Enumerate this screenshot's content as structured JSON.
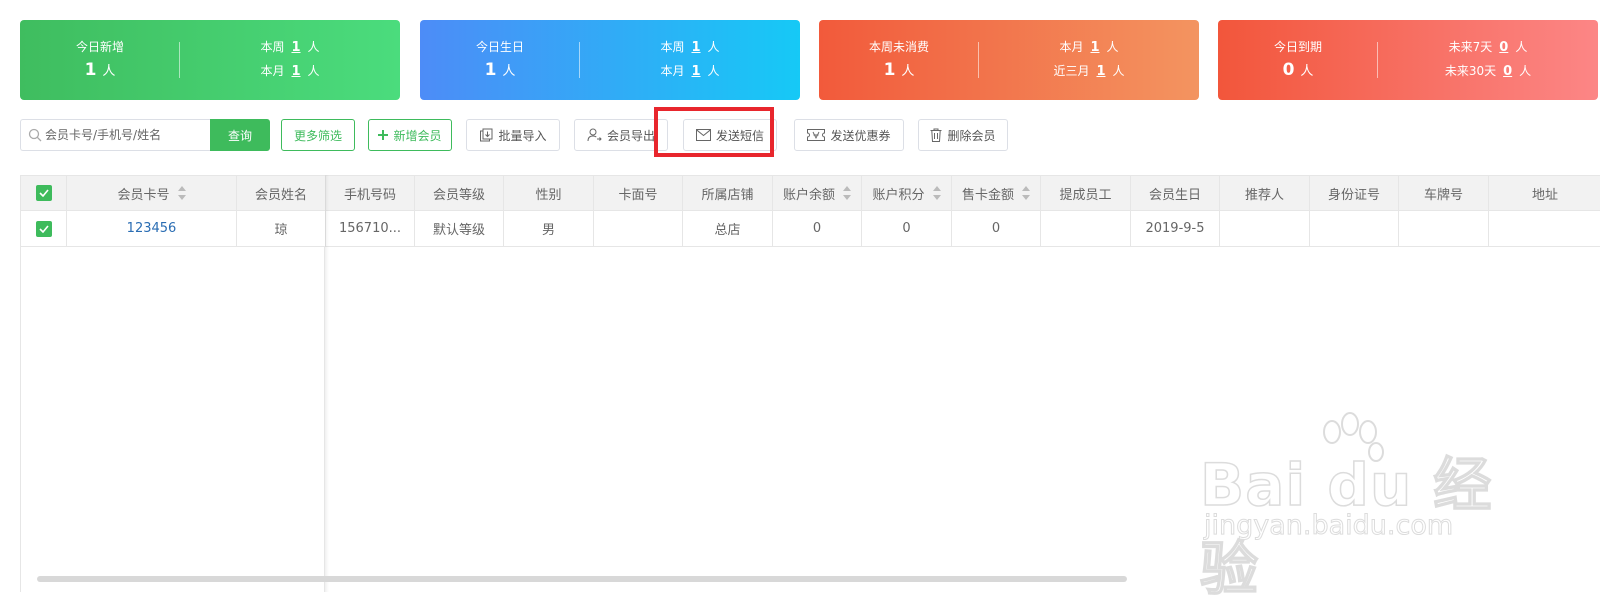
{
  "stats": [
    {
      "title": "今日新增",
      "value": "1",
      "unit": "人",
      "rows": [
        {
          "label": "本周",
          "value": "1",
          "unit": "人"
        },
        {
          "label": "本月",
          "value": "1",
          "unit": "人"
        }
      ]
    },
    {
      "title": "今日生日",
      "value": "1",
      "unit": "人",
      "rows": [
        {
          "label": "本周",
          "value": "1",
          "unit": "人"
        },
        {
          "label": "本月",
          "value": "1",
          "unit": "人"
        }
      ]
    },
    {
      "title": "本周未消费",
      "value": "1",
      "unit": "人",
      "rows": [
        {
          "label": "本月",
          "value": "1",
          "unit": "人"
        },
        {
          "label": "近三月",
          "value": "1",
          "unit": "人"
        }
      ]
    },
    {
      "title": "今日到期",
      "value": "0",
      "unit": "人",
      "rows": [
        {
          "label": "未来7天",
          "value": "0",
          "unit": "人"
        },
        {
          "label": "未来30天",
          "value": "0",
          "unit": "人"
        }
      ]
    }
  ],
  "toolbar": {
    "search_placeholder": "会员卡号/手机号/姓名",
    "query": "查询",
    "more_filter": "更多筛选",
    "add_member": "新增会员",
    "batch_import": "批量导入",
    "export_members": "会员导出",
    "send_sms": "发送短信",
    "send_coupon": "发送优惠券",
    "delete_member": "删除会员"
  },
  "table": {
    "headers": [
      "会员卡号",
      "会员姓名",
      "手机号码",
      "会员等级",
      "性别",
      "卡面号",
      "所属店铺",
      "账户余额",
      "账户积分",
      "售卡金额",
      "提成员工",
      "会员生日",
      "推荐人",
      "身份证号",
      "车牌号",
      "地址"
    ],
    "rows": [
      [
        "123456",
        "琼",
        "156710...",
        "默认等级",
        "男",
        "",
        "总店",
        "0",
        "0",
        "0",
        "",
        "2019-9-5",
        "",
        "",
        "",
        ""
      ]
    ]
  },
  "watermark": {
    "brand": "Bai du 经验",
    "url": "jingyan.baidu.com"
  },
  "colors": {
    "accent": "#3ebb5c",
    "link": "#2a6db3",
    "highlight": "#e8262d"
  }
}
